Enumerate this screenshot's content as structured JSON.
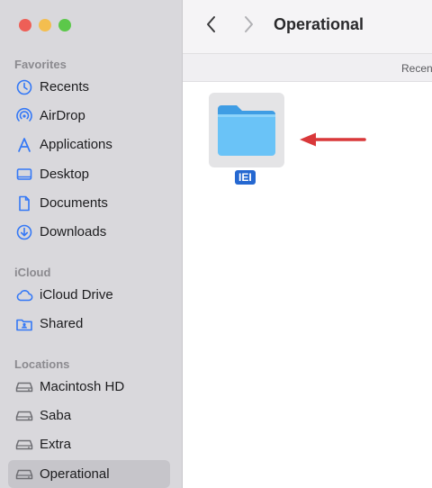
{
  "window": {
    "title": "Operational",
    "column_header": "Recents"
  },
  "sidebar": {
    "sections": [
      {
        "label": "Favorites",
        "items": [
          {
            "label": "Recents",
            "icon": "clock-icon"
          },
          {
            "label": "AirDrop",
            "icon": "airdrop-icon"
          },
          {
            "label": "Applications",
            "icon": "applications-icon"
          },
          {
            "label": "Desktop",
            "icon": "desktop-icon"
          },
          {
            "label": "Documents",
            "icon": "document-icon"
          },
          {
            "label": "Downloads",
            "icon": "download-icon"
          }
        ]
      },
      {
        "label": "iCloud",
        "items": [
          {
            "label": "iCloud Drive",
            "icon": "cloud-icon"
          },
          {
            "label": "Shared",
            "icon": "shared-folder-icon"
          }
        ]
      },
      {
        "label": "Locations",
        "items": [
          {
            "label": "Macintosh HD",
            "icon": "disk-icon"
          },
          {
            "label": "Saba",
            "icon": "disk-icon"
          },
          {
            "label": "Extra",
            "icon": "disk-icon"
          },
          {
            "label": "Operational",
            "icon": "disk-icon",
            "selected": true
          }
        ]
      }
    ]
  },
  "content": {
    "folder": {
      "label": "IEI",
      "icon": "folder-icon"
    },
    "annotation": "red-arrow-icon"
  },
  "colors": {
    "accent": "#2568d1",
    "sidebar_icon": "#3478f6",
    "folder": "#6ac3f7",
    "arrow": "#d9383a"
  }
}
